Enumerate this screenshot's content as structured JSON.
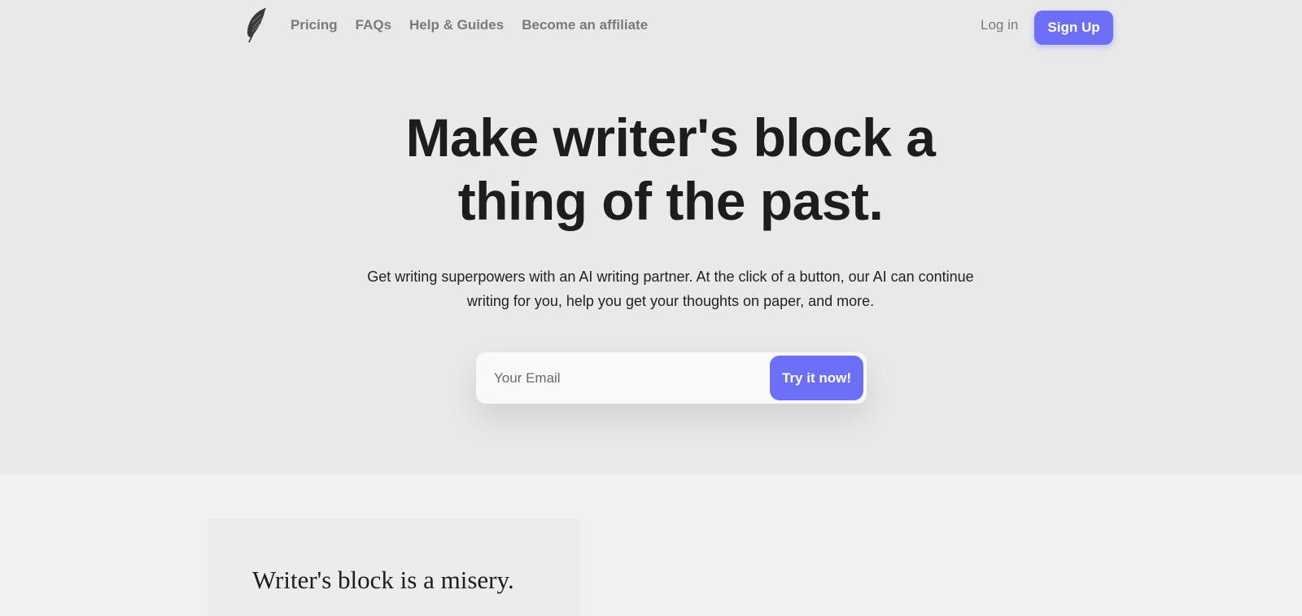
{
  "nav": {
    "logo_icon": "quill-feather-icon",
    "links": [
      "Pricing",
      "FAQs",
      "Help & Guides",
      "Become an affiliate"
    ],
    "login_label": "Log in",
    "signup_label": "Sign Up"
  },
  "hero": {
    "headline_line1": "Make writer's block a",
    "headline_line2": "thing of the past.",
    "subtext_line1": "Get writing superpowers with an AI writing partner. At the click of a button, our AI can continue",
    "subtext_line2": "writing for you, help you get your thoughts on paper, and more.",
    "email_placeholder": "Your Email",
    "email_value": "",
    "cta_label": "Try it now!"
  },
  "section": {
    "card_title": "Writer's block is a misery."
  },
  "colors": {
    "accent": "#6d70f7",
    "hero_bg": "#e9e9ea",
    "page_bg": "#f1f1f1",
    "text": "#1d1d1d",
    "nav_text": "#7a7a7a"
  }
}
